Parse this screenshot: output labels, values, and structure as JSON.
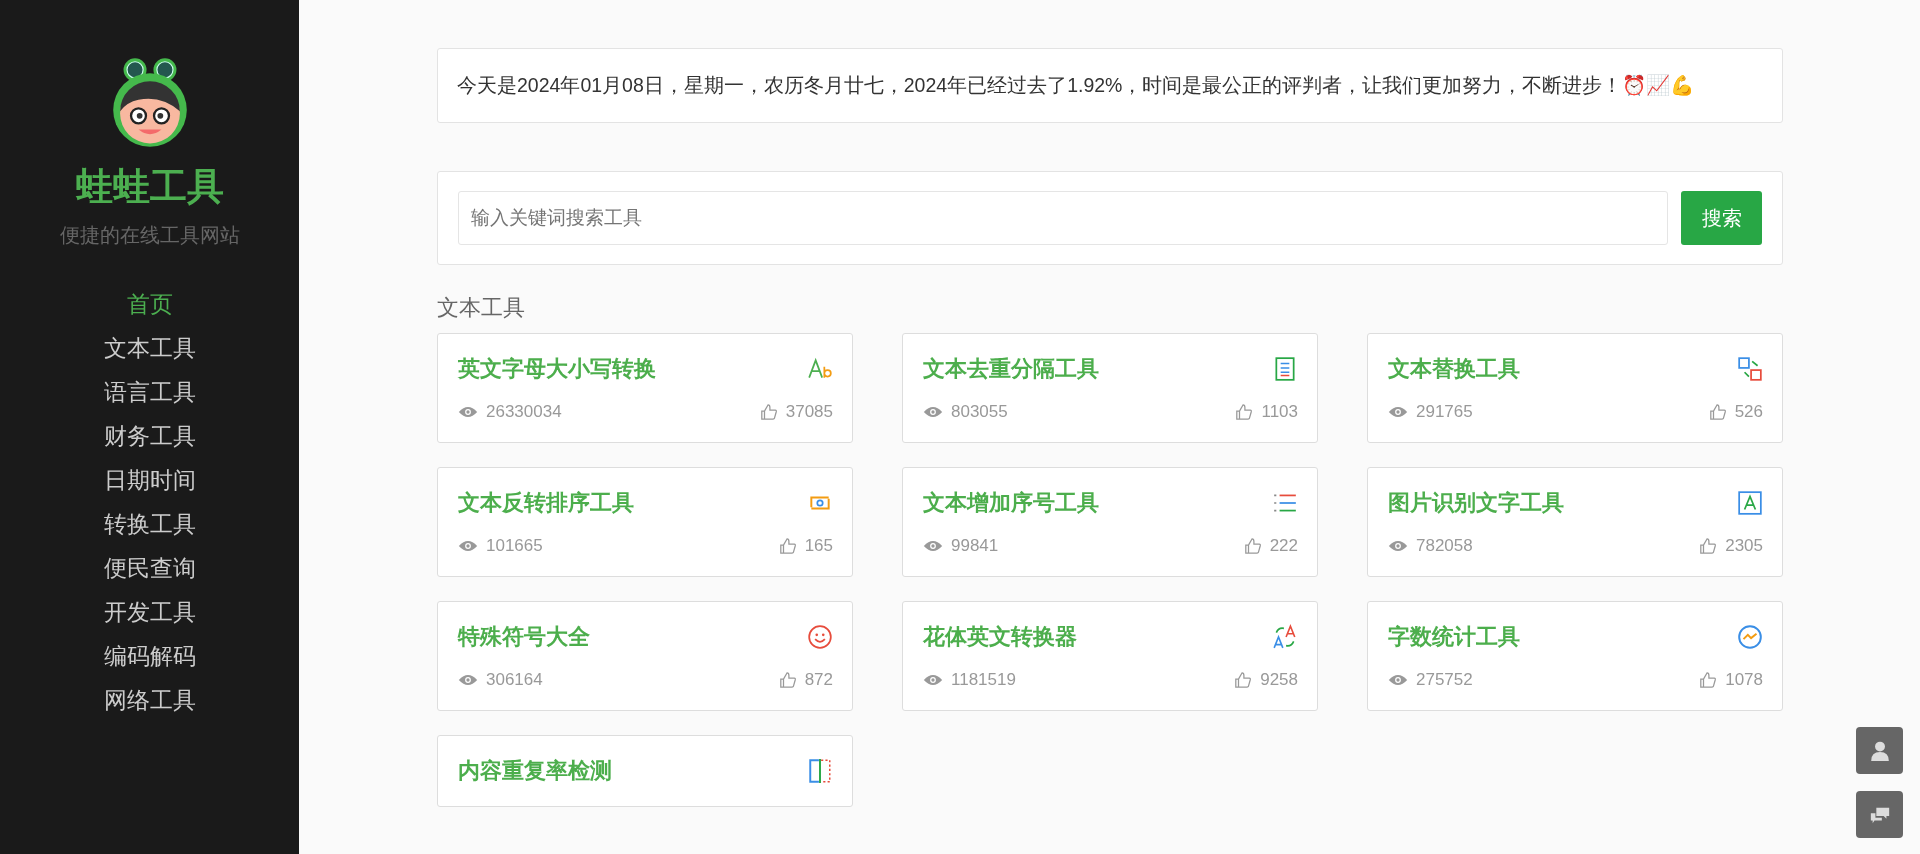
{
  "sidebar": {
    "site_name": "蛙蛙工具",
    "tagline": "便捷的在线工具网站",
    "items": [
      {
        "label": "首页",
        "selected": true
      },
      {
        "label": "文本工具",
        "selected": false
      },
      {
        "label": "语言工具",
        "selected": false
      },
      {
        "label": "财务工具",
        "selected": false
      },
      {
        "label": "日期时间",
        "selected": false
      },
      {
        "label": "转换工具",
        "selected": false
      },
      {
        "label": "便民查询",
        "selected": false
      },
      {
        "label": "开发工具",
        "selected": false
      },
      {
        "label": "编码解码",
        "selected": false
      },
      {
        "label": "网络工具",
        "selected": false
      }
    ]
  },
  "notice": "今天是2024年01月08日，星期一，农历冬月廿七，2024年已经过去了1.92%，时间是最公正的评判者，让我们更加努力，不断进步！⏰📈💪",
  "search": {
    "placeholder": "输入关键词搜索工具",
    "button": "搜索"
  },
  "section_title": "文本工具",
  "tools": [
    {
      "title": "英文字母大小写转换",
      "views": "26330034",
      "likes": "37085"
    },
    {
      "title": "文本去重分隔工具",
      "views": "803055",
      "likes": "1103"
    },
    {
      "title": "文本替换工具",
      "views": "291765",
      "likes": "526"
    },
    {
      "title": "文本反转排序工具",
      "views": "101665",
      "likes": "165"
    },
    {
      "title": "文本增加序号工具",
      "views": "99841",
      "likes": "222"
    },
    {
      "title": "图片识别文字工具",
      "views": "782058",
      "likes": "2305"
    },
    {
      "title": "特殊符号大全",
      "views": "306164",
      "likes": "872"
    },
    {
      "title": "花体英文转换器",
      "views": "1181519",
      "likes": "9258"
    },
    {
      "title": "字数统计工具",
      "views": "275752",
      "likes": "1078"
    },
    {
      "title": "内容重复率检测"
    }
  ]
}
